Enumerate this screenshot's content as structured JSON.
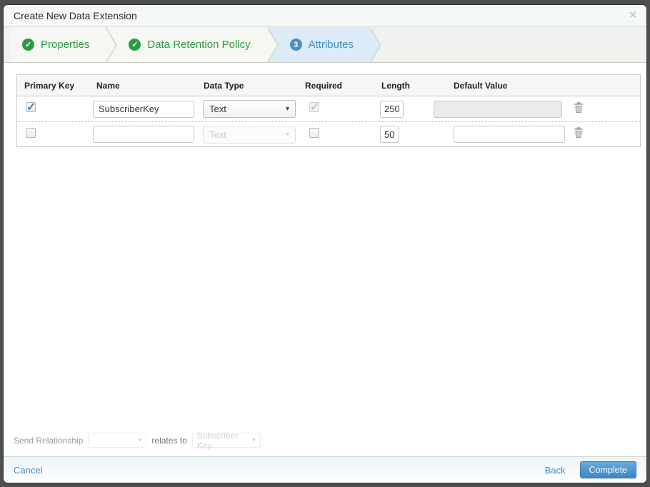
{
  "window": {
    "title": "Create New Data Extension",
    "close_glyph": "×"
  },
  "wizard": {
    "check_glyph": "✓",
    "steps": [
      {
        "label": "Properties",
        "state": "complete"
      },
      {
        "label": "Data Retention Policy",
        "state": "complete"
      },
      {
        "label": "Attributes",
        "state": "active",
        "number": "3"
      }
    ]
  },
  "attributes_table": {
    "headers": [
      "Primary Key",
      "Name",
      "Data Type",
      "Required",
      "Length",
      "Default Value"
    ],
    "dropdown_arrow": "▾",
    "rows": [
      {
        "primary_key_checked": true,
        "name": "SubscriberKey",
        "data_type": "Text",
        "data_type_disabled": false,
        "required_checked": true,
        "required_disabled": true,
        "length": "250",
        "default_value": "",
        "default_disabled": true
      },
      {
        "primary_key_checked": false,
        "name": "",
        "data_type": "Text",
        "data_type_disabled": true,
        "required_checked": false,
        "required_disabled": false,
        "length": "50",
        "default_value": "",
        "default_disabled": false
      }
    ]
  },
  "send_relationship": {
    "label": "Send Relationship",
    "selected_value": "",
    "relates_to": "relates to",
    "target_value": "Subscriber Key"
  },
  "footer": {
    "cancel": "Cancel",
    "back": "Back",
    "complete": "Complete"
  },
  "colors": {
    "step_green": "#2d9a44",
    "step_blue": "#4090c9",
    "active_step_bg": "#dcebf5",
    "primary_button": "#3e86c7",
    "link_blue": "#3e8cc7"
  }
}
